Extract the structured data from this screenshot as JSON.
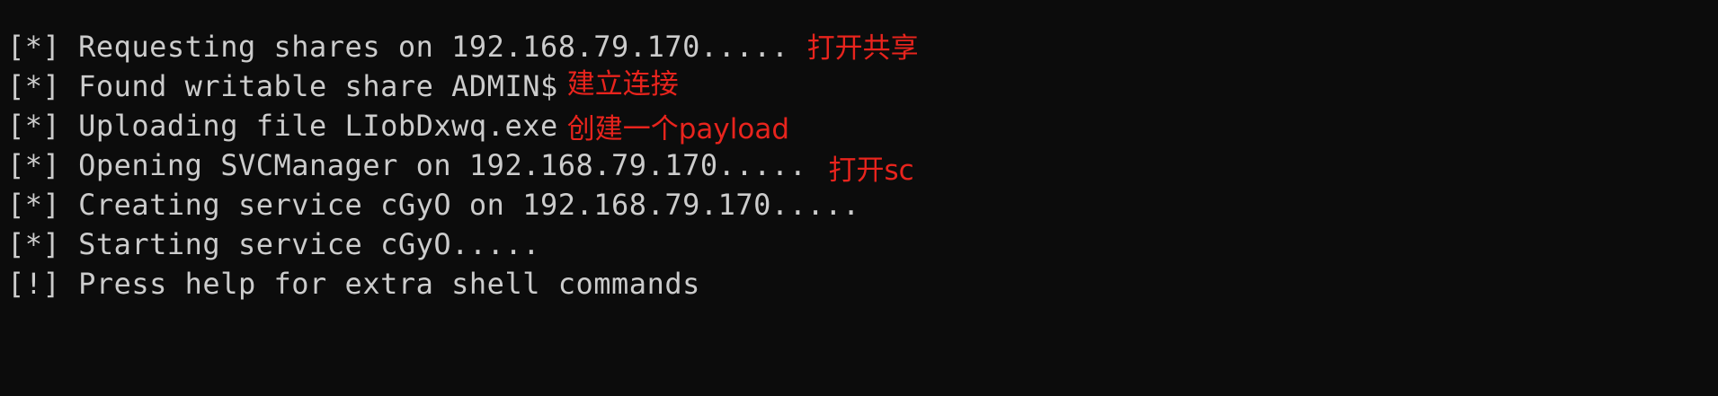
{
  "terminal": {
    "lines": [
      {
        "prefix": "[*]",
        "text": "Requesting shares on 192.168.79.170.....",
        "annotation": "打开共享"
      },
      {
        "prefix": "[*]",
        "text": "Found writable share ADMIN$",
        "annotation": "建立连接"
      },
      {
        "prefix": "[*]",
        "text": "Uploading file LIobDxwq.exe",
        "annotation": "创建一个payload"
      },
      {
        "prefix": "[*]",
        "text": "Opening SVCManager on 192.168.79.170.....",
        "annotation": "打开sc"
      },
      {
        "prefix": "[*]",
        "text": "Creating service cGyO on 192.168.79.170....."
      },
      {
        "prefix": "[*]",
        "text": "Starting service cGyO....."
      },
      {
        "prefix": "[!]",
        "text": "Press help for extra shell commands"
      }
    ]
  },
  "colors": {
    "background": "#0c0c0c",
    "terminal_text": "#cccccc",
    "annotation_text": "#e8241d"
  }
}
